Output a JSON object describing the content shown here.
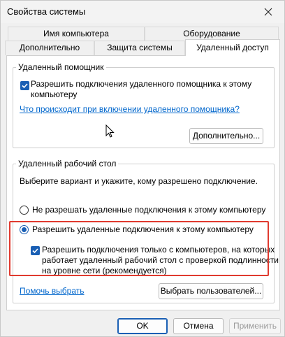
{
  "window": {
    "title": "Свойства системы",
    "close_icon": "close-icon"
  },
  "tabs": {
    "row1": [
      {
        "label": "Имя компьютера"
      },
      {
        "label": "Оборудование"
      }
    ],
    "row2": [
      {
        "label": "Дополнительно"
      },
      {
        "label": "Защита системы"
      },
      {
        "label": "Удаленный доступ",
        "active": true
      }
    ]
  },
  "remote_assistance": {
    "legend": "Удаленный помощник",
    "allow_checkbox": {
      "line1": "Разрешить подключения удаленного помощника к этому",
      "line2": "компьютеру",
      "checked": true
    },
    "info_link": "Что происходит при включении удаленного помощника?",
    "advanced_button": "Дополнительно..."
  },
  "remote_desktop": {
    "legend": "Удаленный рабочий стол",
    "instruction": "Выберите вариант и укажите, кому разрешено подключение.",
    "deny_radio": {
      "label": "Не разрешать удаленные подключения к этому компьютеру",
      "checked": false
    },
    "allow_radio": {
      "label": "Разрешить удаленные подключения к этому компьютеру",
      "checked": true
    },
    "nla_checkbox": {
      "line1": "Разрешить подключения только с компьютеров, на которых",
      "line2": "работает удаленный рабочий стол с проверкой подлинности",
      "line3": "на уровне сети (рекомендуется)",
      "checked": true
    },
    "help_link": "Помочь выбрать",
    "select_users_button": "Выбрать пользователей..."
  },
  "footer": {
    "ok": "OK",
    "cancel": "Отмена",
    "apply": "Применить"
  },
  "colors": {
    "accent": "#1a5fb4",
    "link": "#0066cc",
    "highlight": "#e03a2f"
  }
}
